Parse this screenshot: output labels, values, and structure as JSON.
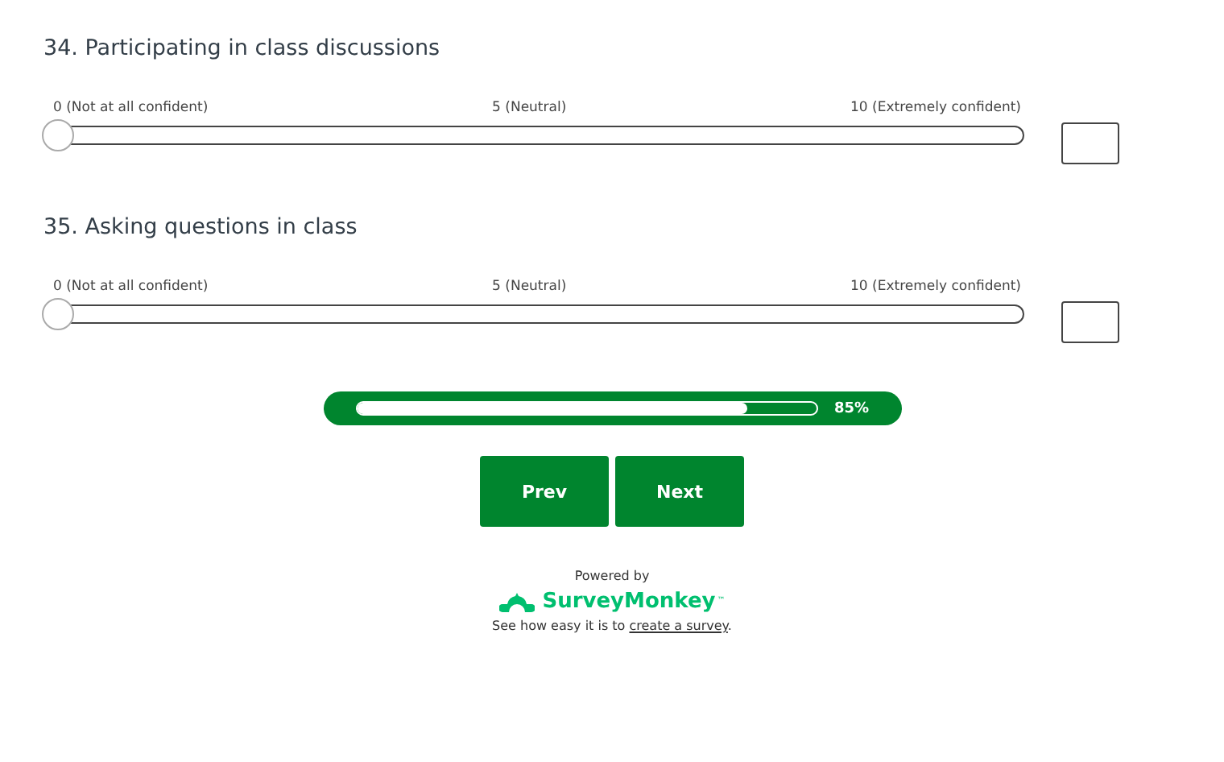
{
  "questions": [
    {
      "title": "34. Participating in class discussions",
      "labels": [
        "0 (Not at all confident)",
        "5 (Neutral)",
        "10 (Extremely confident)"
      ],
      "level": 0
    },
    {
      "title": "35. Asking questions in class",
      "labels": [
        "0 (Not at all confident)",
        "5 (Neutral)",
        "10 (Extremely confident)"
      ],
      "level": 0
    }
  ],
  "progress": {
    "level": 0.85,
    "reading": "85%"
  },
  "buttons": [
    "Prev",
    "Next"
  ],
  "footer": {
    "powered_by": "Powered by",
    "brand": "SurveyMonkey",
    "trademark": "™",
    "text": "See how easy it is to ",
    "link": "create a survey",
    "end": "."
  }
}
